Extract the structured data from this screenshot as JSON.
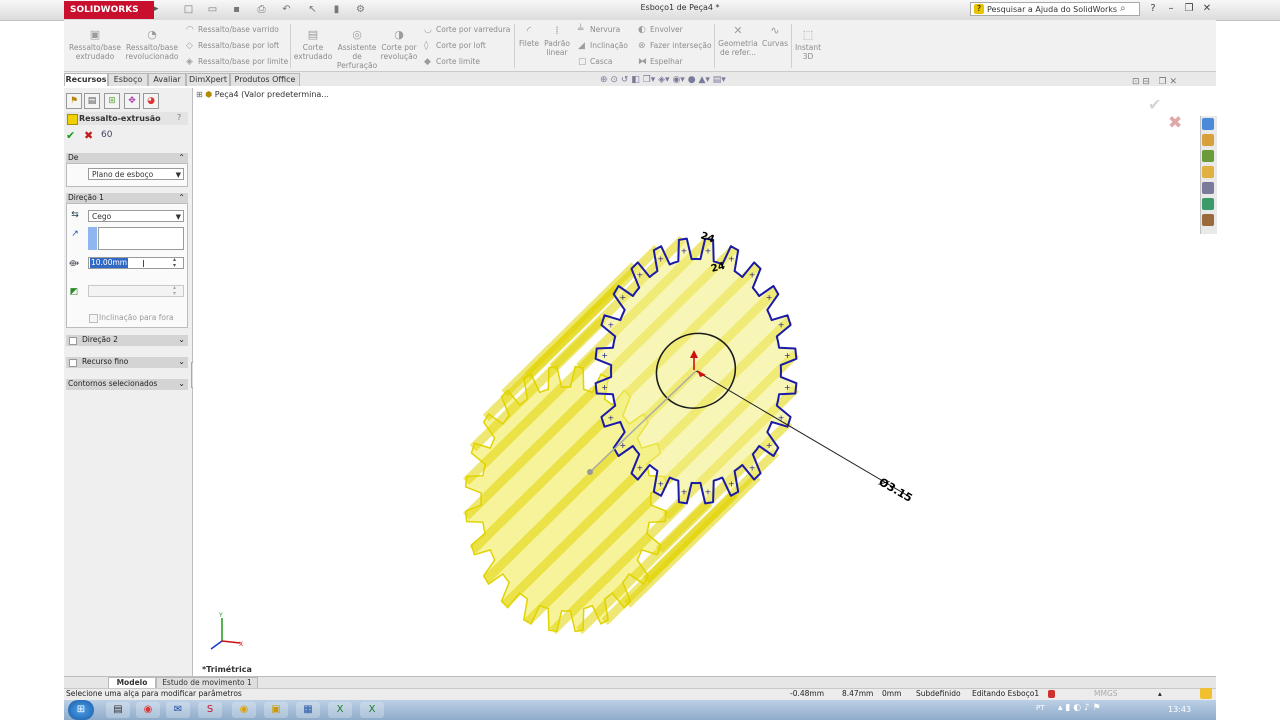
{
  "app": {
    "logo_text": "SOLIDWORKS",
    "document_title": "Esboço1 de Peça4 *",
    "help_search_placeholder": "Pesquisar a Ajuda do SolidWorks",
    "help_icon_glyph": "?"
  },
  "quick_access": {
    "icons": [
      "new-icon",
      "open-icon",
      "save-icon",
      "print-icon",
      "undo-icon",
      "select-icon",
      "rebuild-icon",
      "options-icon"
    ]
  },
  "ribbon": {
    "big_buttons": [
      {
        "label": "Ressalto/base extrudado",
        "icon": "extrude-boss-icon"
      },
      {
        "label": "Ressalto/base revolucionado",
        "icon": "revolve-boss-icon"
      },
      {
        "label": "Corte extrudado",
        "icon": "extruded-cut-icon"
      },
      {
        "label": "Assistente de Perfuração",
        "icon": "hole-wizard-icon"
      },
      {
        "label": "Corte por revolução",
        "icon": "revolved-cut-icon"
      },
      {
        "label": "Filete",
        "icon": "fillet-icon"
      },
      {
        "label": "Padrão linear",
        "icon": "linear-pattern-icon"
      },
      {
        "label": "Geometria de refer...",
        "icon": "reference-geometry-icon"
      },
      {
        "label": "Curvas",
        "icon": "curves-icon"
      },
      {
        "label": "Instant 3D",
        "icon": "instant3d-icon"
      }
    ],
    "small_rows": [
      {
        "label": "Ressalto/base varrido",
        "icon": "sweep-boss-icon"
      },
      {
        "label": "Ressalto/base por loft",
        "icon": "loft-boss-icon"
      },
      {
        "label": "Ressalto/base por limite",
        "icon": "boundary-boss-icon"
      },
      {
        "label": "Corte por varredura",
        "icon": "swept-cut-icon"
      },
      {
        "label": "Corte por loft",
        "icon": "lofted-cut-icon"
      },
      {
        "label": "Corte limite",
        "icon": "boundary-cut-icon"
      },
      {
        "label": "Nervura",
        "icon": "rib-icon"
      },
      {
        "label": "Inclinação",
        "icon": "draft-icon"
      },
      {
        "label": "Casca",
        "icon": "shell-icon"
      },
      {
        "label": "Envolver",
        "icon": "wrap-icon"
      },
      {
        "label": "Fazer interseção",
        "icon": "intersect-icon"
      },
      {
        "label": "Espelhar",
        "icon": "mirror-icon"
      }
    ]
  },
  "command_tabs": [
    "Recursos",
    "Esboço",
    "Avaliar",
    "DimXpert",
    "Produtos Office"
  ],
  "property_manager": {
    "tab_icons": [
      "feature-manager-icon",
      "property-manager-icon",
      "configuration-icon",
      "dimxpert-manager-icon",
      "display-manager-icon"
    ],
    "title": "Ressalto-extrusão",
    "help_glyph": "?",
    "from_section": {
      "label": "De",
      "start_condition": "Plano de esboço"
    },
    "direction1": {
      "label": "Direção 1",
      "end_condition": "Cego",
      "depth_value": "10.00mm",
      "draft_outward_label": "Inclinação para fora"
    },
    "direction2_label": "Direção 2",
    "thin_feature_label": "Recurso fino",
    "selected_contours_label": "Contornos selecionados"
  },
  "feature_tree": {
    "root_label": "Peça4  (Valor predetermina..."
  },
  "viewport": {
    "view_label": "*Trimétrica",
    "dimension_small_1": "24",
    "dimension_small_2": "24",
    "diameter_dimension": "Ø3.15",
    "gear_teeth_count": 24,
    "colors": {
      "gear_fill": "#f3ef7a",
      "gear_edge": "#e0d300",
      "sketch": "#1a1aa6",
      "dimension": "#000000"
    }
  },
  "heads_up_toolbar": {
    "icons": [
      "zoom-fit-icon",
      "zoom-area-icon",
      "previous-view-icon",
      "section-view-icon",
      "view-orientation-icon",
      "display-style-icon",
      "hide-show-icon",
      "edit-appearance-icon",
      "apply-scene-icon",
      "view-settings-icon"
    ]
  },
  "bottom_tabs": [
    "Modelo",
    "Estudo de movimento 1"
  ],
  "status_bar": {
    "message": "Selecione uma alça para modificar parâmetros",
    "x": "-0.48mm",
    "y": "8.47mm",
    "z": "0mm",
    "state": "Subdefinido",
    "editing": "Editando Esboço1",
    "units": "MMGS"
  },
  "taskbar": {
    "apps": [
      "windows-start-icon",
      "explorer-icon",
      "chrome-icon",
      "outlook-icon",
      "solidworks-icon",
      "chrome-2-icon",
      "folder-icon",
      "notepad-icon",
      "excel-icon",
      "excel-2-icon"
    ],
    "language": "PT",
    "time": "13:43"
  }
}
